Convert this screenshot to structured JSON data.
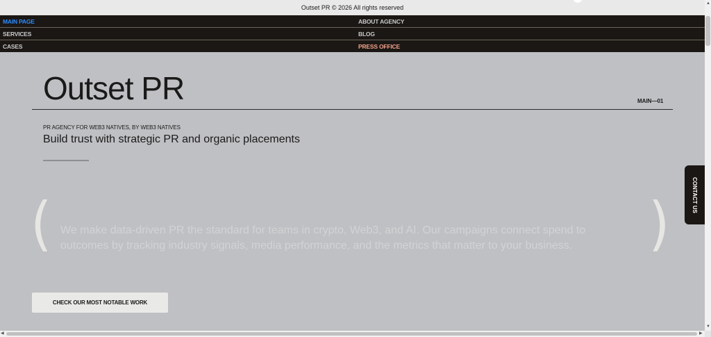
{
  "topbar": {
    "copyright": "Outset PR © 2026 All rights reserved"
  },
  "nav": {
    "rows": [
      {
        "left": "MAIN PAGE",
        "right": "ABOUT AGENCY"
      },
      {
        "left": "SERVICES",
        "right": "BLOG"
      },
      {
        "left": "CASES",
        "right": "PRESS OFFICE"
      }
    ],
    "active_color": "#2e8bff",
    "accent_color": "#f2a08a"
  },
  "hero": {
    "title": "Outset PR",
    "page_index": "MAIN—01",
    "eyebrow": "PR AGENCY FOR WEB3 NATIVES, BY WEB3 NATIVES",
    "subtitle": "Build trust with strategic PR and organic placements"
  },
  "quote": {
    "text": "We make data-driven PR the standard for teams in crypto, Web3, and AI. Our campaigns connect spend to outcomes by tracking industry signals, media performance, and the metrics that matter to your business.",
    "open_bracket": "(",
    "close_bracket": ")"
  },
  "cta": {
    "label": "CHECK OUR MOST NOTABLE WORK"
  },
  "contact_tab": {
    "label": "CONTACT US"
  },
  "scrollbar": {
    "up": "▲",
    "down": "▼",
    "left": "◀",
    "right": "▶"
  },
  "colors": {
    "page_bg": "#bfc0c3",
    "nav_bg": "#1b1714",
    "cta_bg": "#e9e9e7"
  }
}
